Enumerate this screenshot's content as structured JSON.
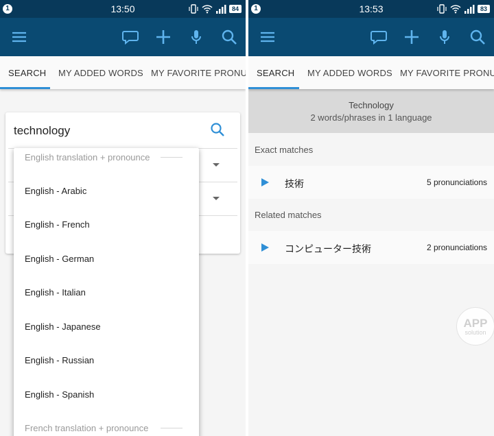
{
  "left": {
    "status": {
      "notification": "1",
      "time": "13:50",
      "battery": "84"
    },
    "tabs": [
      "SEARCH",
      "MY ADDED WORDS",
      "MY FAVORITE PRONUNC"
    ],
    "search": {
      "value": "technology"
    },
    "dropdown": {
      "headers": [
        "English translation + pronounce",
        "French translation + pronounce"
      ],
      "items": [
        "English - Arabic",
        "English - French",
        "English - German",
        "English - Italian",
        "English - Japanese",
        "English - Russian",
        "English - Spanish"
      ]
    }
  },
  "right": {
    "status": {
      "notification": "1",
      "time": "13:53",
      "battery": "83"
    },
    "tabs": [
      "SEARCH",
      "MY ADDED WORDS",
      "MY FAVORITE PRONUNC"
    ],
    "term": {
      "title": "Technology",
      "subtitle": "2 words/phrases in 1 language"
    },
    "exact": {
      "heading": "Exact matches",
      "items": [
        {
          "word": "技術",
          "count": "5 pronunciations"
        }
      ]
    },
    "related": {
      "heading": "Related matches",
      "items": [
        {
          "word": "コンピューター技術",
          "count": "2 pronunciations"
        }
      ]
    }
  },
  "watermark": {
    "line1": "APP",
    "line2": "solution"
  },
  "icons": [
    "menu-icon",
    "chat-icon",
    "plus-icon",
    "mic-icon",
    "search-icon",
    "vibrate-icon",
    "wifi-icon",
    "signal-icon",
    "play-icon",
    "dropdown-caret-icon"
  ],
  "colors": {
    "status_bar": "#08395a",
    "app_bar": "#0a4a72",
    "accent": "#2f8fd6",
    "term_bg": "#d9d9d9"
  }
}
